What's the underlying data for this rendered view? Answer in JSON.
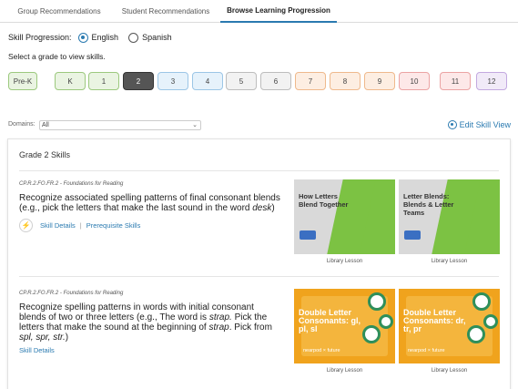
{
  "tabs": [
    {
      "label": "Group Recommendations"
    },
    {
      "label": "Student Recommendations"
    },
    {
      "label": "Browse Learning Progression",
      "active": true
    }
  ],
  "progression": {
    "label": "Skill Progression:",
    "options": [
      {
        "label": "English",
        "selected": true
      },
      {
        "label": "Spanish",
        "selected": false
      }
    ]
  },
  "grade_prompt": "Select a grade to view skills.",
  "grades": [
    {
      "label": "Pre-K",
      "bg": "#eaf4e2",
      "border": "#9cc97e",
      "selected": false
    },
    {
      "label": "K",
      "bg": "#eaf4e2",
      "border": "#9cc97e",
      "selected": false
    },
    {
      "label": "1",
      "bg": "#eaf4e2",
      "border": "#9cc97e",
      "selected": false
    },
    {
      "label": "2",
      "bg": "#555555",
      "border": "#333333",
      "selected": true
    },
    {
      "label": "3",
      "bg": "#e6f2fb",
      "border": "#9cc6e6",
      "selected": false
    },
    {
      "label": "4",
      "bg": "#e6f2fb",
      "border": "#9cc6e6",
      "selected": false
    },
    {
      "label": "5",
      "bg": "#f2f2f2",
      "border": "#bdbdbd",
      "selected": false
    },
    {
      "label": "6",
      "bg": "#f2f2f2",
      "border": "#bdbdbd",
      "selected": false
    },
    {
      "label": "7",
      "bg": "#fdeee2",
      "border": "#efb98c",
      "selected": false
    },
    {
      "label": "8",
      "bg": "#fdeee2",
      "border": "#efb98c",
      "selected": false
    },
    {
      "label": "9",
      "bg": "#fdeee2",
      "border": "#efb98c",
      "selected": false
    },
    {
      "label": "10",
      "bg": "#fde8e8",
      "border": "#eba3a3",
      "selected": false
    },
    {
      "label": "11",
      "bg": "#fde8e8",
      "border": "#eba3a3",
      "selected": false
    },
    {
      "label": "12",
      "bg": "#f1eaf8",
      "border": "#c3a9e0",
      "selected": false
    }
  ],
  "domains": {
    "label": "Domains:",
    "value": "All"
  },
  "edit_skill_view": "Edit Skill View",
  "panel_title": "Grade 2 Skills",
  "skills": [
    {
      "code": "CP.R.2.FO.FR.2 - Foundations for Reading",
      "description": "Recognize associated spelling patterns of final consonant blends (e.g., pick the letters that make the last sound in the word desk)",
      "links": [
        "Skill Details",
        "Prerequisite Skills"
      ],
      "lessons": [
        {
          "title": "How Letters Blend Together",
          "caption": "Library Lesson",
          "style": "grey"
        },
        {
          "title": "Letter Blends: Blends & Letter Teams",
          "caption": "Library Lesson",
          "style": "grey"
        }
      ]
    },
    {
      "code": "CP.R.2.FO.FR.2 - Foundations for Reading",
      "description": "Recognize spelling patterns in words with initial consonant blends of two or three letters (e.g., The word is strap. Pick the letters that make the sound at the beginning of strap. Pick from spl, spr, str.)",
      "links": [
        "Skill Details"
      ],
      "lessons": [
        {
          "title": "Double Letter Consonants: gl, pl, sl",
          "caption": "Library Lesson",
          "style": "orange",
          "footer": "nearpod × future"
        },
        {
          "title": "Double Letter Consonants: dr, tr, pr",
          "caption": "Library Lesson",
          "style": "orange",
          "footer": "nearpod × future"
        }
      ]
    }
  ],
  "colors": {
    "accent": "#2a7ab0",
    "green": "#7cc243",
    "orange": "#f0a31d"
  }
}
